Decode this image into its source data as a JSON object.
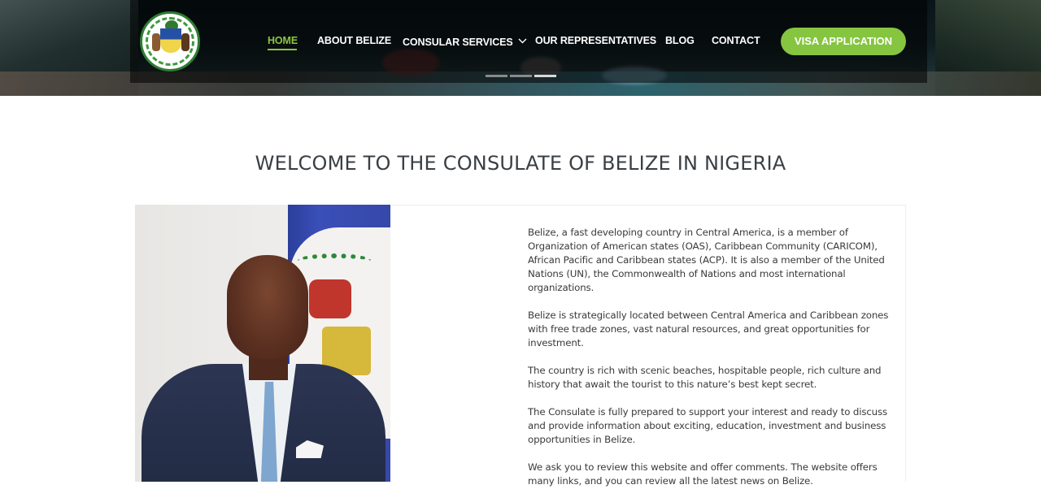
{
  "header": {
    "logo_alt": "Belize Coat of Arms",
    "nav": [
      {
        "label": "HOME",
        "active": true
      },
      {
        "label": "ABOUT BELIZE",
        "active": false
      },
      {
        "label": "CONSULAR SERVICES",
        "active": false,
        "has_dropdown": true
      },
      {
        "label": "OUR REPRESENTATIVES",
        "active": false
      },
      {
        "label": "BLOG",
        "active": false
      },
      {
        "label": "CONTACT",
        "active": false
      }
    ],
    "cta_label": "VISA APPLICATION",
    "slider": {
      "count": 3,
      "active_index": 2
    }
  },
  "main": {
    "title": "WELCOME TO THE CONSULATE OF BELIZE IN NIGERIA",
    "paragraphs": [
      "Belize, a fast developing country in Central America, is a member of Organization of American states (OAS), Caribbean Community (CARICOM), African Pacific and Caribbean states (ACP). It is also a member of the United Nations (UN), the Commonwealth of Nations and most international organizations.",
      "Belize is strategically located between Central America and Caribbean zones with free trade zones, vast natural resources, and great opportunities for investment.",
      "The country is rich with scenic beaches, hospitable people, rich culture and history that await the tourist to this nature’s best kept secret.",
      "The Consulate is fully prepared to support your interest and ready to discuss and provide information about exciting, education, investment and business opportunities in Belize.",
      "We ask you to review this website and offer comments. The website offers many links, and you can review all the latest news on Belize."
    ]
  },
  "colors": {
    "accent": "#8dc63f",
    "cta": "#86c540",
    "title": "#3a3f44",
    "body_text": "#3a3a3a"
  }
}
